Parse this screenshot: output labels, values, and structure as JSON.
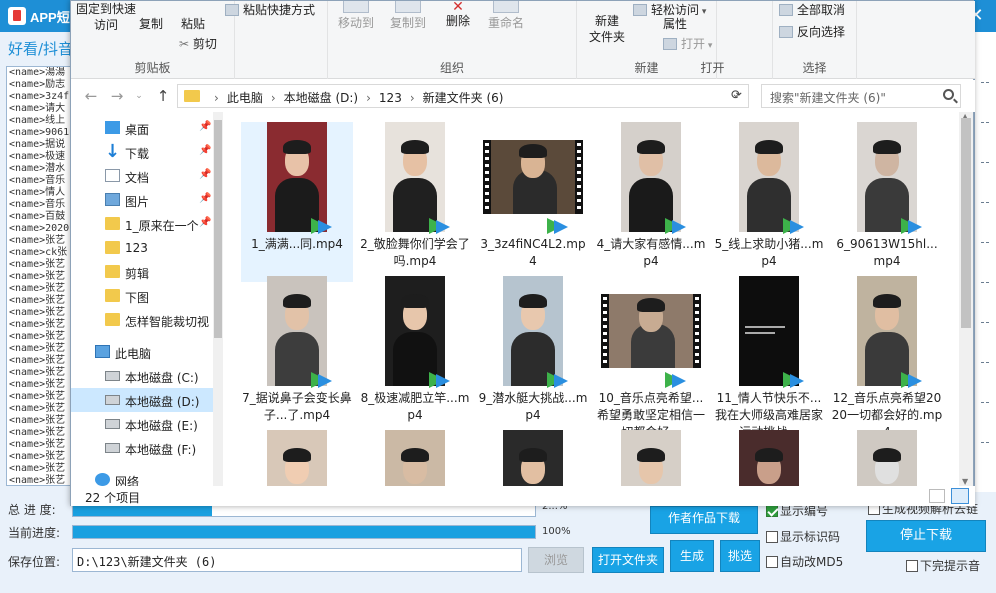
{
  "app": {
    "title": "APP短",
    "heading": "好看/抖音",
    "close": "✕",
    "list_lines": [
      "<name>湯湯",
      "<name>励志",
      "<name>3z4f",
      "<name>请大",
      "<name>线上",
      "<name>9061",
      "<name>据说",
      "<name>极速",
      "<name>潜水",
      "<name>音乐",
      "<name>情人",
      "<name>音乐",
      "<name>百鼓",
      "<name>2020",
      "<name>张艺",
      "<name>ck张",
      "<name>张艺",
      "<name>张艺",
      "<name>张艺",
      "<name>张艺",
      "<name>张艺",
      "<name>张艺",
      "<name>张艺",
      "<name>张艺",
      "<name>张艺",
      "<name>张艺",
      "<name>张艺",
      "<name>张艺",
      "<name>张艺",
      "<name>张艺",
      "<name>张艺",
      "<name>张艺",
      "<name>张艺",
      "<name>张艺",
      "<name>张艺"
    ],
    "total_progress_label": "总 进 度:",
    "total_progress_text": "2...%",
    "total_progress": 0.3,
    "current_progress_label": "当前进度:",
    "current_progress_text": "100%",
    "current_progress": 1.0,
    "save_label": "保存位置:",
    "save_path": "D:\\123\\新建文件夹 (6)",
    "btn_browse": "浏览",
    "btn_open_folder": "打开文件夹",
    "btn_generate": "生成",
    "btn_select": "挑选",
    "btn_author_download": "作者作品下载",
    "btn_stop": "停止下载",
    "chk_show_number": "显示编号",
    "chk_show_mark": "显示标识码",
    "chk_auto_md5": "自动改MD5",
    "chk_complete_tip": "下完提示音",
    "chk_top_right": "生成视频解析去链"
  },
  "explorer": {
    "ribbon": {
      "clipboard": {
        "label": "剪贴板",
        "pin": "固定到快速访问",
        "copy": "复制",
        "paste": "粘贴",
        "paste_shortcut": "粘贴快捷方式",
        "cut": "剪切"
      },
      "organize": {
        "label": "组织",
        "move_to": "移动到",
        "copy_to": "复制到",
        "delete": "删除",
        "rename": "重命名"
      },
      "new": {
        "label": "新建",
        "new_folder": "新建\n文件夹",
        "easy_access": "轻松访问"
      },
      "open": {
        "label": "打开",
        "properties": "属性",
        "open": "打开"
      },
      "select": {
        "label": "选择",
        "select_none": "全部取消",
        "invert": "反向选择"
      }
    },
    "address": {
      "crumbs": [
        "此电脑",
        "本地磁盘 (D:)",
        "123",
        "新建文件夹 (6)"
      ],
      "search_placeholder": "搜索\"新建文件夹 (6)\""
    },
    "nav": [
      {
        "label": "桌面",
        "icon": "desktop-icon",
        "pinned": true
      },
      {
        "label": "下载",
        "icon": "download-icon",
        "pinned": true
      },
      {
        "label": "文档",
        "icon": "document-icon",
        "pinned": true
      },
      {
        "label": "图片",
        "icon": "picture-icon",
        "pinned": true
      },
      {
        "label": "1_原来在一个",
        "icon": "folder-icon",
        "pinned": true
      },
      {
        "label": "123",
        "icon": "folder-icon",
        "pinned": false
      },
      {
        "label": "剪辑",
        "icon": "folder-icon",
        "pinned": false
      },
      {
        "label": "下图",
        "icon": "folder-icon",
        "pinned": false
      },
      {
        "label": "怎样智能裁切视",
        "icon": "folder-icon",
        "pinned": false
      },
      {
        "label": "此电脑",
        "icon": "pc-icon",
        "pinned": false
      },
      {
        "label": "本地磁盘 (C:)",
        "icon": "disk-icon",
        "pinned": false
      },
      {
        "label": "本地磁盘 (D:)",
        "icon": "disk-icon",
        "pinned": false,
        "selected": true
      },
      {
        "label": "本地磁盘 (E:)",
        "icon": "disk-icon",
        "pinned": false
      },
      {
        "label": "本地磁盘 (F:)",
        "icon": "disk-icon",
        "pinned": false
      },
      {
        "label": "网络",
        "icon": "network-icon",
        "pinned": false
      }
    ],
    "files": [
      {
        "name": "1_满满...同.mp4",
        "selected": true
      },
      {
        "name": "2_敬脸舞你们学会了吗.mp4"
      },
      {
        "name": "3_3z4fiNC4L2.mp4"
      },
      {
        "name": "4_请大家有感情...mp4"
      },
      {
        "name": "5_线上求助小猪...mp4"
      },
      {
        "name": "6_90613W15hl...mp4"
      },
      {
        "name": "7_据说鼻子会变长鼻子...了.mp4"
      },
      {
        "name": "8_极速减肥立竿...mp4"
      },
      {
        "name": "9_潜水艇大挑战...mp4"
      },
      {
        "name": "10_音乐点亮希望...希望勇敢坚定相信一切都会好..."
      },
      {
        "name": "11_情人节快乐不...我在大师级高难居家运动挑战..."
      },
      {
        "name": "12_音乐点亮希望2020一切都会好的.mp4"
      },
      {
        "name": ""
      },
      {
        "name": ""
      },
      {
        "name": ""
      },
      {
        "name": ""
      },
      {
        "name": ""
      },
      {
        "name": ""
      }
    ],
    "status_count": "22 个项目"
  }
}
